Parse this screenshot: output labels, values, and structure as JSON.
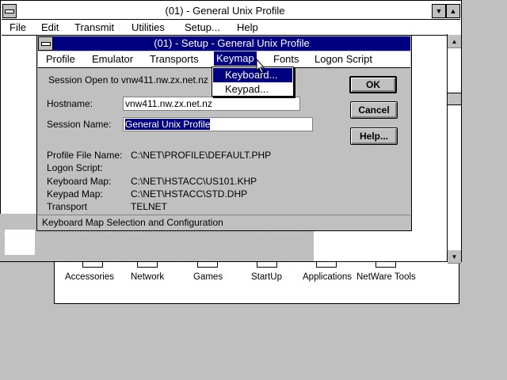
{
  "main_window": {
    "title": "(01) - General Unix Profile",
    "menu": [
      "File",
      "Edit",
      "Transmit",
      "Utilities",
      "Setup...",
      "Help"
    ]
  },
  "program_group": {
    "items": [
      "Accessories",
      "Network",
      "Games",
      "StartUp",
      "Applications",
      "NetWare Tools"
    ]
  },
  "dialog": {
    "title": "(01) - Setup - General Unix Profile",
    "menu": [
      "Profile",
      "Emulator",
      "Transports",
      "Keymap",
      "Fonts",
      "Logon Script"
    ],
    "session_open_text": "Session Open to vnw411.nw.zx.net.nz",
    "hostname_label": "Hostname:",
    "hostname_value": "vnw411.nw.zx.net.nz",
    "session_name_label": "Session Name:",
    "session_name_value": "General Unix Profile",
    "info": [
      {
        "label": "Profile File Name:",
        "value": "C:\\NET\\PROFILE\\DEFAULT.PHP"
      },
      {
        "label": "Logon Script:",
        "value": ""
      },
      {
        "label": "Keyboard Map:",
        "value": "C:\\NET\\HSTACC\\US101.KHP"
      },
      {
        "label": "Keypad Map:",
        "value": "C:\\NET\\HSTACC\\STD.DHP"
      },
      {
        "label": "Transport",
        "value": "TELNET"
      }
    ],
    "buttons": {
      "ok": "OK",
      "cancel": "Cancel",
      "help": "Help..."
    },
    "status": "Keyboard Map Selection and Configuration"
  },
  "keymap_dropdown": {
    "items": [
      "Keyboard...",
      "Keypad..."
    ],
    "highlighted": 0
  },
  "colors": {
    "active_title": "#000080",
    "face": "#c0c0c0",
    "highlight_text": "#ffffff"
  }
}
